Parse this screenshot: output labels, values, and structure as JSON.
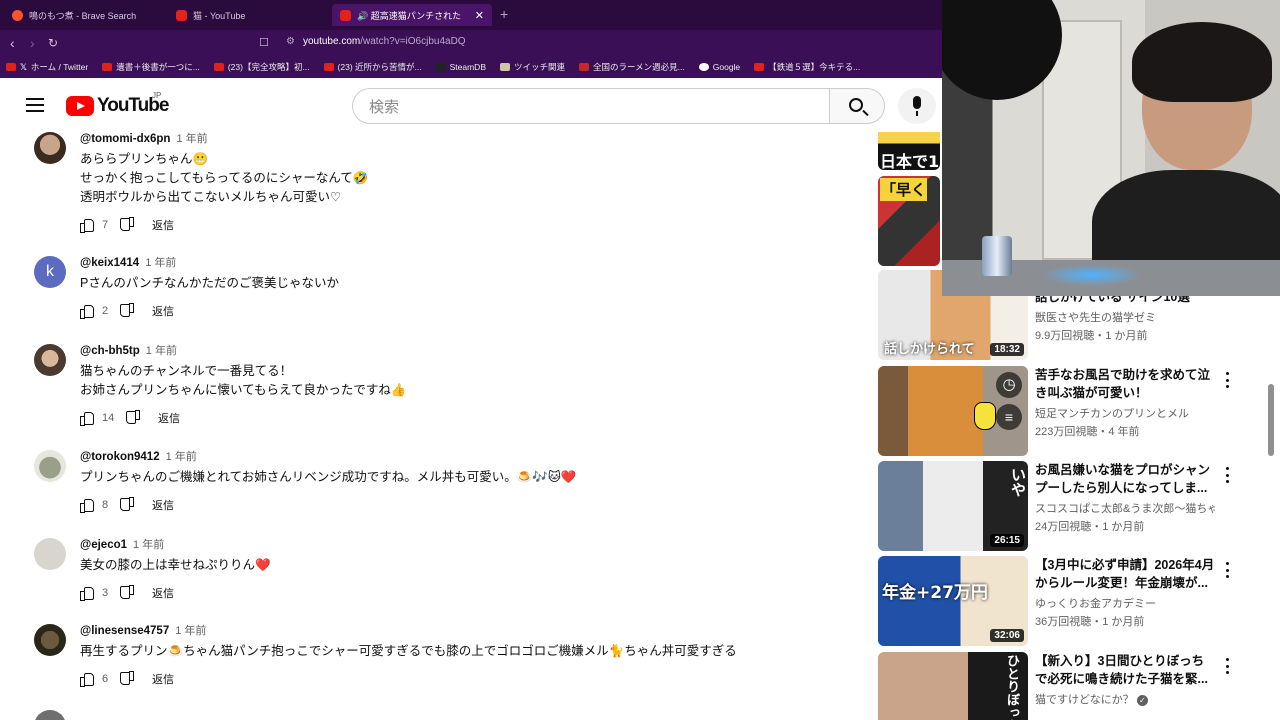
{
  "browser": {
    "tabs": [
      {
        "title": "鳴のもつ煮 - Brave Search",
        "icon": "brave-icon",
        "active": false
      },
      {
        "title": "猫 - YouTube",
        "icon": "youtube-icon",
        "active": false
      },
      {
        "title": "🔊 超高速猫パンチされた姉がリベン",
        "icon": "youtube-icon",
        "active": true
      }
    ],
    "url_host": "youtube.com",
    "url_path": "/watch?v=iO6cjbu4aDQ",
    "bookmarks": [
      {
        "label": "ホーム / Twitter",
        "icon": "x-icon"
      },
      {
        "label": "遺書＋後書が一つに...",
        "icon": "bookmark-icon"
      },
      {
        "label": "(23)【完全攻略】初...",
        "icon": "youtube-icon"
      },
      {
        "label": "(23) 近所から苦情が...",
        "icon": "youtube-icon"
      },
      {
        "label": "SteamDB",
        "icon": "steam-icon"
      },
      {
        "label": "ツイッチ関連",
        "icon": "folder-icon"
      },
      {
        "label": "全国のラーメン週必見...",
        "icon": "bookmark-icon"
      },
      {
        "label": "Google",
        "icon": "google-icon"
      },
      {
        "label": "【鉄道５選】今キテる...",
        "icon": "youtube-icon"
      }
    ]
  },
  "youtube": {
    "logo_text": "YouTube",
    "region": "JP",
    "search_placeholder": "検索"
  },
  "comments": [
    {
      "handle": "@tomomi-dx6pn",
      "time": "1 年前",
      "lines": [
        "あららプリンちゃん😬",
        "せっかく抱っこしてもらってるのにシャーなんて🤣",
        "透明ボウルから出てこないメルちゃん可愛い♡"
      ],
      "likes": "7",
      "reply": "返信",
      "avatar": "photo1"
    },
    {
      "handle": "@keix1414",
      "time": "1 年前",
      "lines": [
        "Pさんのパンチなんかただのご褒美じゃないか"
      ],
      "likes": "2",
      "reply": "返信",
      "avatar": "k",
      "avatar_letter": "k"
    },
    {
      "handle": "@ch-bh5tp",
      "time": "1 年前",
      "lines": [
        "猫ちゃんのチャンネルで一番見てる！",
        "お姉さんプリンちゃんに懐いてもらえて良かったですね👍"
      ],
      "likes": "14",
      "reply": "返信",
      "avatar": "photo2"
    },
    {
      "handle": "@torokon9412",
      "time": "1 年前",
      "lines": [
        "プリンちゃんのご機嫌とれてお姉さんリベンジ成功ですね。メル丼も可愛い。🍮🎶🐱❤️"
      ],
      "likes": "8",
      "reply": "返信",
      "avatar": "totoro"
    },
    {
      "handle": "@ejeco1",
      "time": "1 年前",
      "lines": [
        "美女の膝の上は幸せねぷりりん❤️"
      ],
      "likes": "3",
      "reply": "返信",
      "avatar": "blank"
    },
    {
      "handle": "@linesense4757",
      "time": "1 年前",
      "lines": [
        "再生するプリン🍮ちゃん猫パンチ抱っこでシャー可愛すぎるでも膝の上でゴロゴロご機嫌メル🐈ちゃん丼可愛すぎる"
      ],
      "likes": "6",
      "reply": "返信",
      "avatar": "dark"
    }
  ],
  "recommendations": [
    {
      "title": "",
      "channel": "",
      "meta": "",
      "duration": "",
      "thumb_text": "日本で1"
    },
    {
      "title": "",
      "channel": "",
      "meta": "",
      "duration": "",
      "thumb_text": "「早く"
    },
    {
      "title": "話しかけている サイン10選",
      "channel": "獣医さや先生の猫学ゼミ",
      "meta": "9.9万回視聴・1 か月前",
      "duration": "18:32",
      "thumb_text": "話しかけられて"
    },
    {
      "title": "苦手なお風呂で助けを求めて泣き叫ぶ猫が可愛い！",
      "channel": "短足マンチカンのプリンとメル",
      "meta": "223万回視聴・4 年前",
      "duration": "",
      "thumb_text": ""
    },
    {
      "title": "お風呂嫌いな猫をプロがシャンプーしたら別人になってしま...",
      "channel": "スコスコぱこ太郎&うま次郎〜猫ちゃん...",
      "meta": "24万回視聴・1 か月前",
      "duration": "26:15",
      "thumb_text": "いや"
    },
    {
      "title": "【3月中に必ず申請】2026年4月からルール変更！年金崩壊が...",
      "channel": "ゆっくりお金アカデミー",
      "meta": "36万回視聴・1 か月前",
      "duration": "32:06",
      "thumb_text": "年金+27万円"
    },
    {
      "title": "【新入り】3日間ひとりぼっちで必死に鳴き続けた子猫を緊...",
      "channel": "猫ですけどなにか？",
      "meta": "",
      "duration": "",
      "thumb_text": "ひとりぼっち"
    }
  ]
}
